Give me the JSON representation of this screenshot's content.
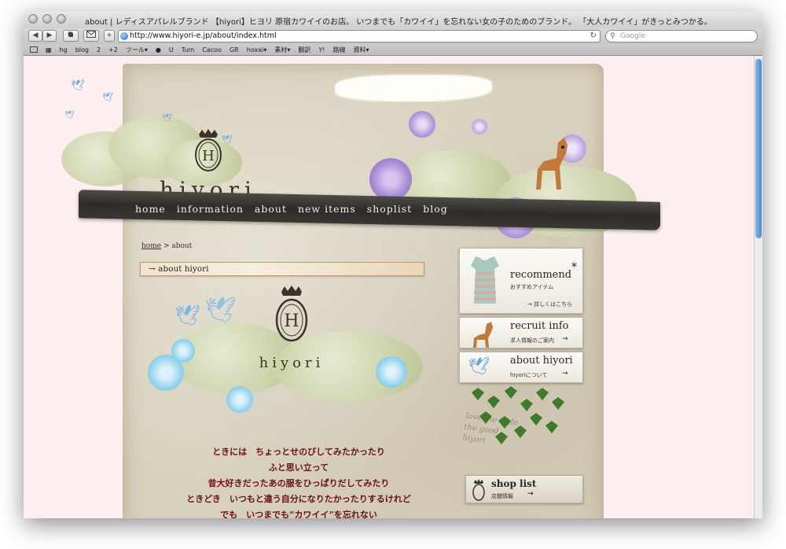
{
  "window": {
    "title": "about | レディスアパレルブランド 【hiyori】ヒヨリ 原宿カワイイのお店。 いつまでも「カワイイ」を忘れない女の子のためのブランド。 「大人カワイイ」がきっとみつかる。",
    "url": "http://www.hiyori-e.jp/about/index.html",
    "search_placeholder": "Google",
    "back_icon": "◀",
    "forward_icon": "▶",
    "add_icon": "+",
    "reload_icon": "↻"
  },
  "bookmarks": [
    "hg",
    "blog",
    "2",
    "+2",
    "ツール▾",
    "",
    "U",
    "Tum",
    "Cacoo",
    "GR",
    "hoxai▾",
    "素材▾",
    "翻訳",
    "Y!",
    "路線",
    "資料▾"
  ],
  "site": {
    "brand": "hiyori",
    "nav": [
      "home",
      "information",
      "about",
      "new items",
      "shoplist",
      "blog"
    ],
    "breadcrumb": {
      "home": "home",
      "separator": " > ",
      "current": "about"
    },
    "section_title": "→ about hiyori",
    "main_brand": "hiyori",
    "poem": [
      "ときには　ちょっとせのびしてみたかったり",
      "ふと思い立って",
      "昔大好きだったあの服をひっぱりだしてみたり",
      "ときどき　いつもと違う自分になりたかったりするけれど",
      "でも　いつまでも”カワイイ”を忘れない"
    ],
    "sidebar": {
      "recommend": {
        "title": "recommend",
        "star": "*",
        "subtitle": "おすすめアイテム",
        "link": "→ 詳しくはこちら"
      },
      "recruit": {
        "title": "recruit info",
        "subtitle": "求人情報のご案内",
        "arrow": "→"
      },
      "about": {
        "title": "about hiyori",
        "subtitle": "hiyoriについて",
        "arrow": "→"
      },
      "shoplist": {
        "title": "shop list",
        "subtitle": "店舗情報",
        "arrow": "→"
      }
    }
  },
  "colors": {
    "page_bg": "#fdefef",
    "paper": "#d8d1bd",
    "nav_bar": "#3a3633",
    "poem_text": "#6a1212"
  }
}
